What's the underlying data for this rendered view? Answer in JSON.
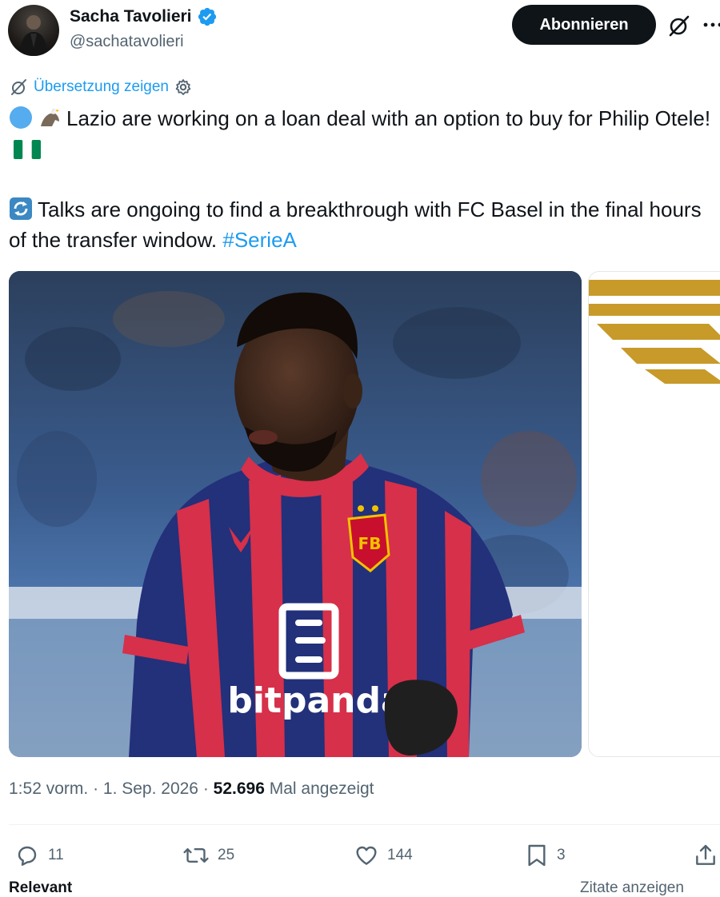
{
  "author": {
    "display_name": "Sacha Tavolieri",
    "handle": "@sachatavolieri",
    "verified": true
  },
  "header": {
    "subscribe_label": "Abonnieren",
    "icons": [
      "grok-icon",
      "more-icon"
    ]
  },
  "translation": {
    "label": "Übersetzung zeigen"
  },
  "tweet": {
    "line1": "Lazio are working on a loan deal with an option to buy for Philip Otele!",
    "line2": "Talks are ongoing to find a breakthrough with FC Basel in the final hours of the transfer window.",
    "hashtag": "#SerieA"
  },
  "media": {
    "shirt_sponsor": "bitpanda"
  },
  "meta": {
    "time": "1:52 vorm.",
    "date": "1. Sep. 2026",
    "views_count": "52.696",
    "views_label": "Mal angezeigt"
  },
  "actions": {
    "replies": "11",
    "reposts": "25",
    "likes": "144",
    "bookmarks": "3"
  },
  "footer": {
    "left_label": "Relevant",
    "right_label": "Zitate anzeigen"
  },
  "colors": {
    "accent": "#1d9bf0",
    "text": "#0f1419",
    "muted": "#536471",
    "button": "#0f1419"
  }
}
